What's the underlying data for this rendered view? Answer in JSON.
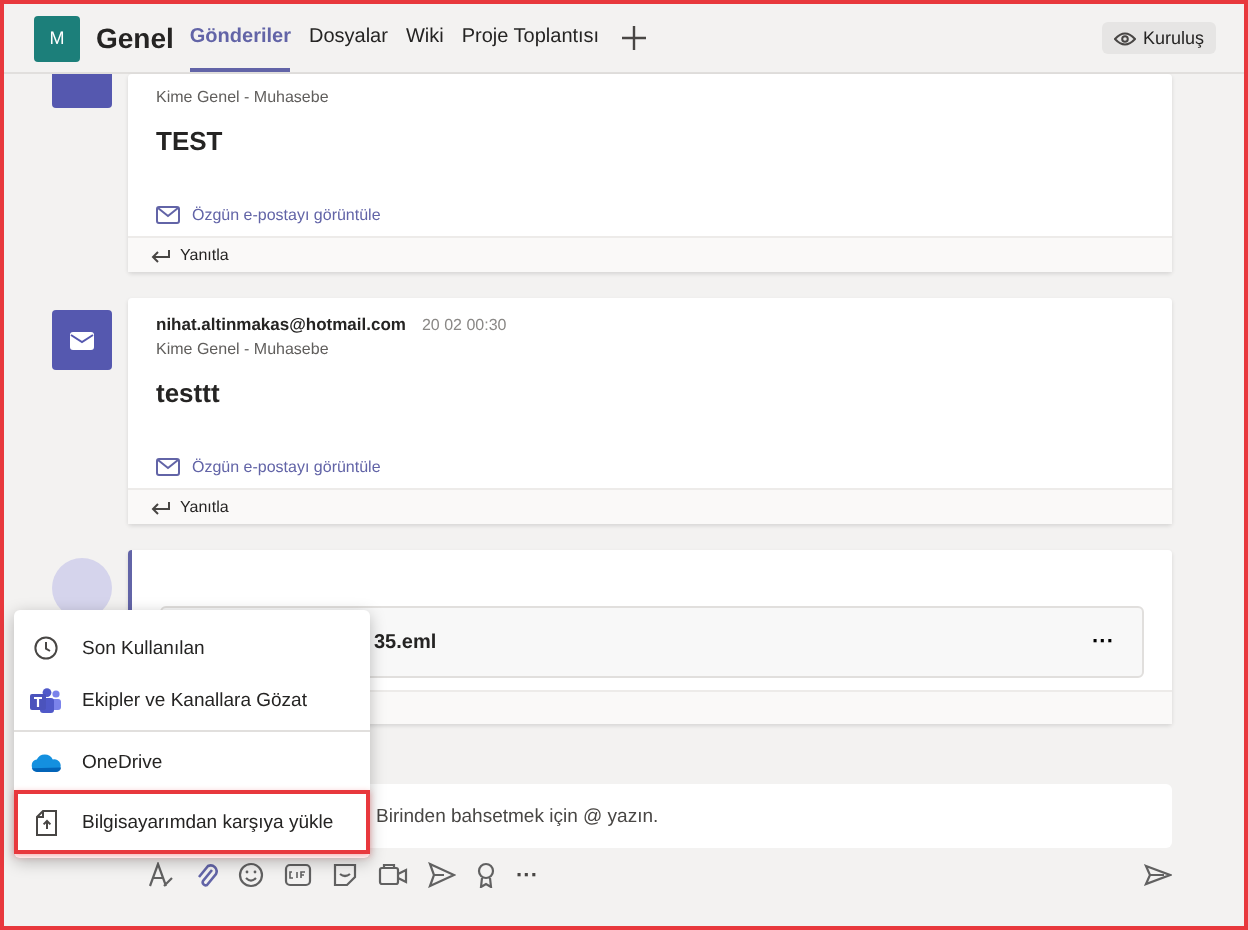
{
  "header": {
    "team_initial": "M",
    "channel": "Genel",
    "tabs": [
      {
        "label": "Gönderiler",
        "selected": true
      },
      {
        "label": "Dosyalar",
        "selected": false
      },
      {
        "label": "Wiki",
        "selected": false
      },
      {
        "label": "Proje Toplantısı",
        "selected": false
      }
    ],
    "org_button": "Kuruluş"
  },
  "messages": [
    {
      "kind": "mail",
      "cut_top": true,
      "to": "Kime Genel - Muhasebe",
      "body": "TEST",
      "link": "Özgün e-postayı görüntüle",
      "reply": "Yanıtla"
    },
    {
      "kind": "mail",
      "cut_top": false,
      "sender": "nihat.altinmakas@hotmail.com",
      "time": "20 02 00:30",
      "to": "Kime Genel - Muhasebe",
      "body": "testtt",
      "link": "Özgün e-postayı görüntüle",
      "reply": "Yanıtla"
    },
    {
      "kind": "file",
      "file_name": "35.eml",
      "more": "···"
    }
  ],
  "compose": {
    "placeholder": "Birinden bahsetmek için @ yazın.",
    "more": "···"
  },
  "attach_menu": {
    "items": [
      {
        "kind": "clock",
        "label": "Son Kullanılan",
        "highlighted": false,
        "divider_after": false
      },
      {
        "kind": "teams",
        "label": "Ekipler ve Kanallara Gözat",
        "highlighted": false,
        "divider_after": true
      },
      {
        "kind": "cloud",
        "label": "OneDrive",
        "highlighted": false,
        "divider_after": false
      },
      {
        "kind": "upload",
        "label": "Bilgisayarımdan karşıya yükle",
        "highlighted": true,
        "divider_after": false
      }
    ]
  }
}
